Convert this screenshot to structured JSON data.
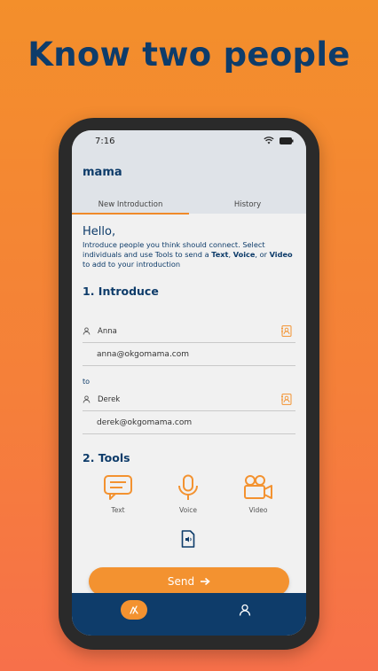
{
  "headline": "Know two people",
  "status": {
    "time": "7:16"
  },
  "app": {
    "name": "mama"
  },
  "tabs": [
    {
      "label": "New Introduction",
      "active": true
    },
    {
      "label": "History",
      "active": false
    }
  ],
  "greeting": "Hello,",
  "intro": {
    "part1": "Introduce people you think should connect. Select individuals and use Tools to send a ",
    "text": "Text",
    "sep1": ", ",
    "voice": "Voice",
    "sep2": ", or ",
    "video": "Video",
    "part2": " to add to your introduction"
  },
  "section1": {
    "title": "1. Introduce"
  },
  "person1": {
    "name": "Anna",
    "email": "anna@okgomama.com"
  },
  "to_label": "to",
  "person2": {
    "name": "Derek",
    "email": "derek@okgomama.com"
  },
  "section2": {
    "title": "2. Tools"
  },
  "tools": [
    {
      "label": "Text",
      "icon": "chat-icon"
    },
    {
      "label": "Voice",
      "icon": "microphone-icon"
    },
    {
      "label": "Video",
      "icon": "video-camera-icon"
    }
  ],
  "send_label": "Send",
  "colors": {
    "accent": "#f39230",
    "navy": "#0e3c6a"
  }
}
